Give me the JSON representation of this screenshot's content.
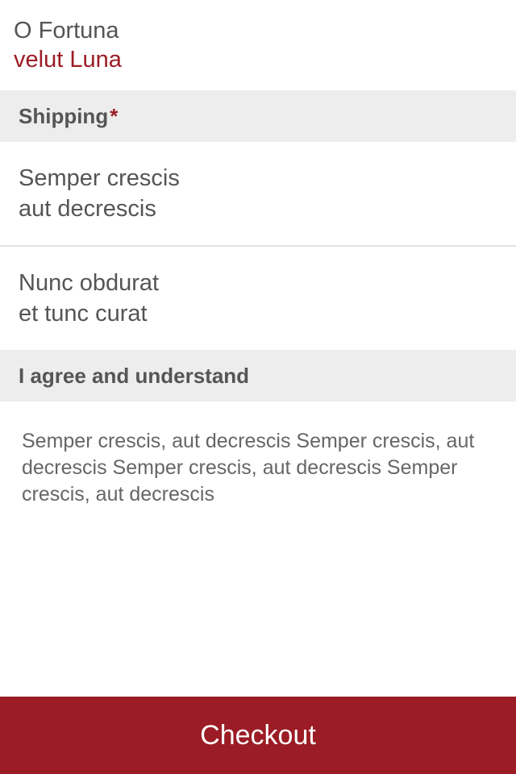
{
  "header": {
    "title": "O Fortuna",
    "subtitle": "velut Luna"
  },
  "shipping": {
    "label": "Shipping",
    "required_mark": "*",
    "options": [
      {
        "line1": "Semper crescis",
        "line2": "aut decrescis"
      },
      {
        "line1": "Nunc obdurat",
        "line2": "et tunc curat"
      }
    ]
  },
  "agreement": {
    "label": "I agree and understand",
    "text": "Semper crescis, aut decrescis Semper crescis, aut decrescis Semper crescis, aut decrescis Semper crescis, aut decrescis"
  },
  "checkout": {
    "label": "Checkout"
  },
  "colors": {
    "accent": "#9b1c25",
    "section_background": "#ededed",
    "text": "#555555"
  }
}
